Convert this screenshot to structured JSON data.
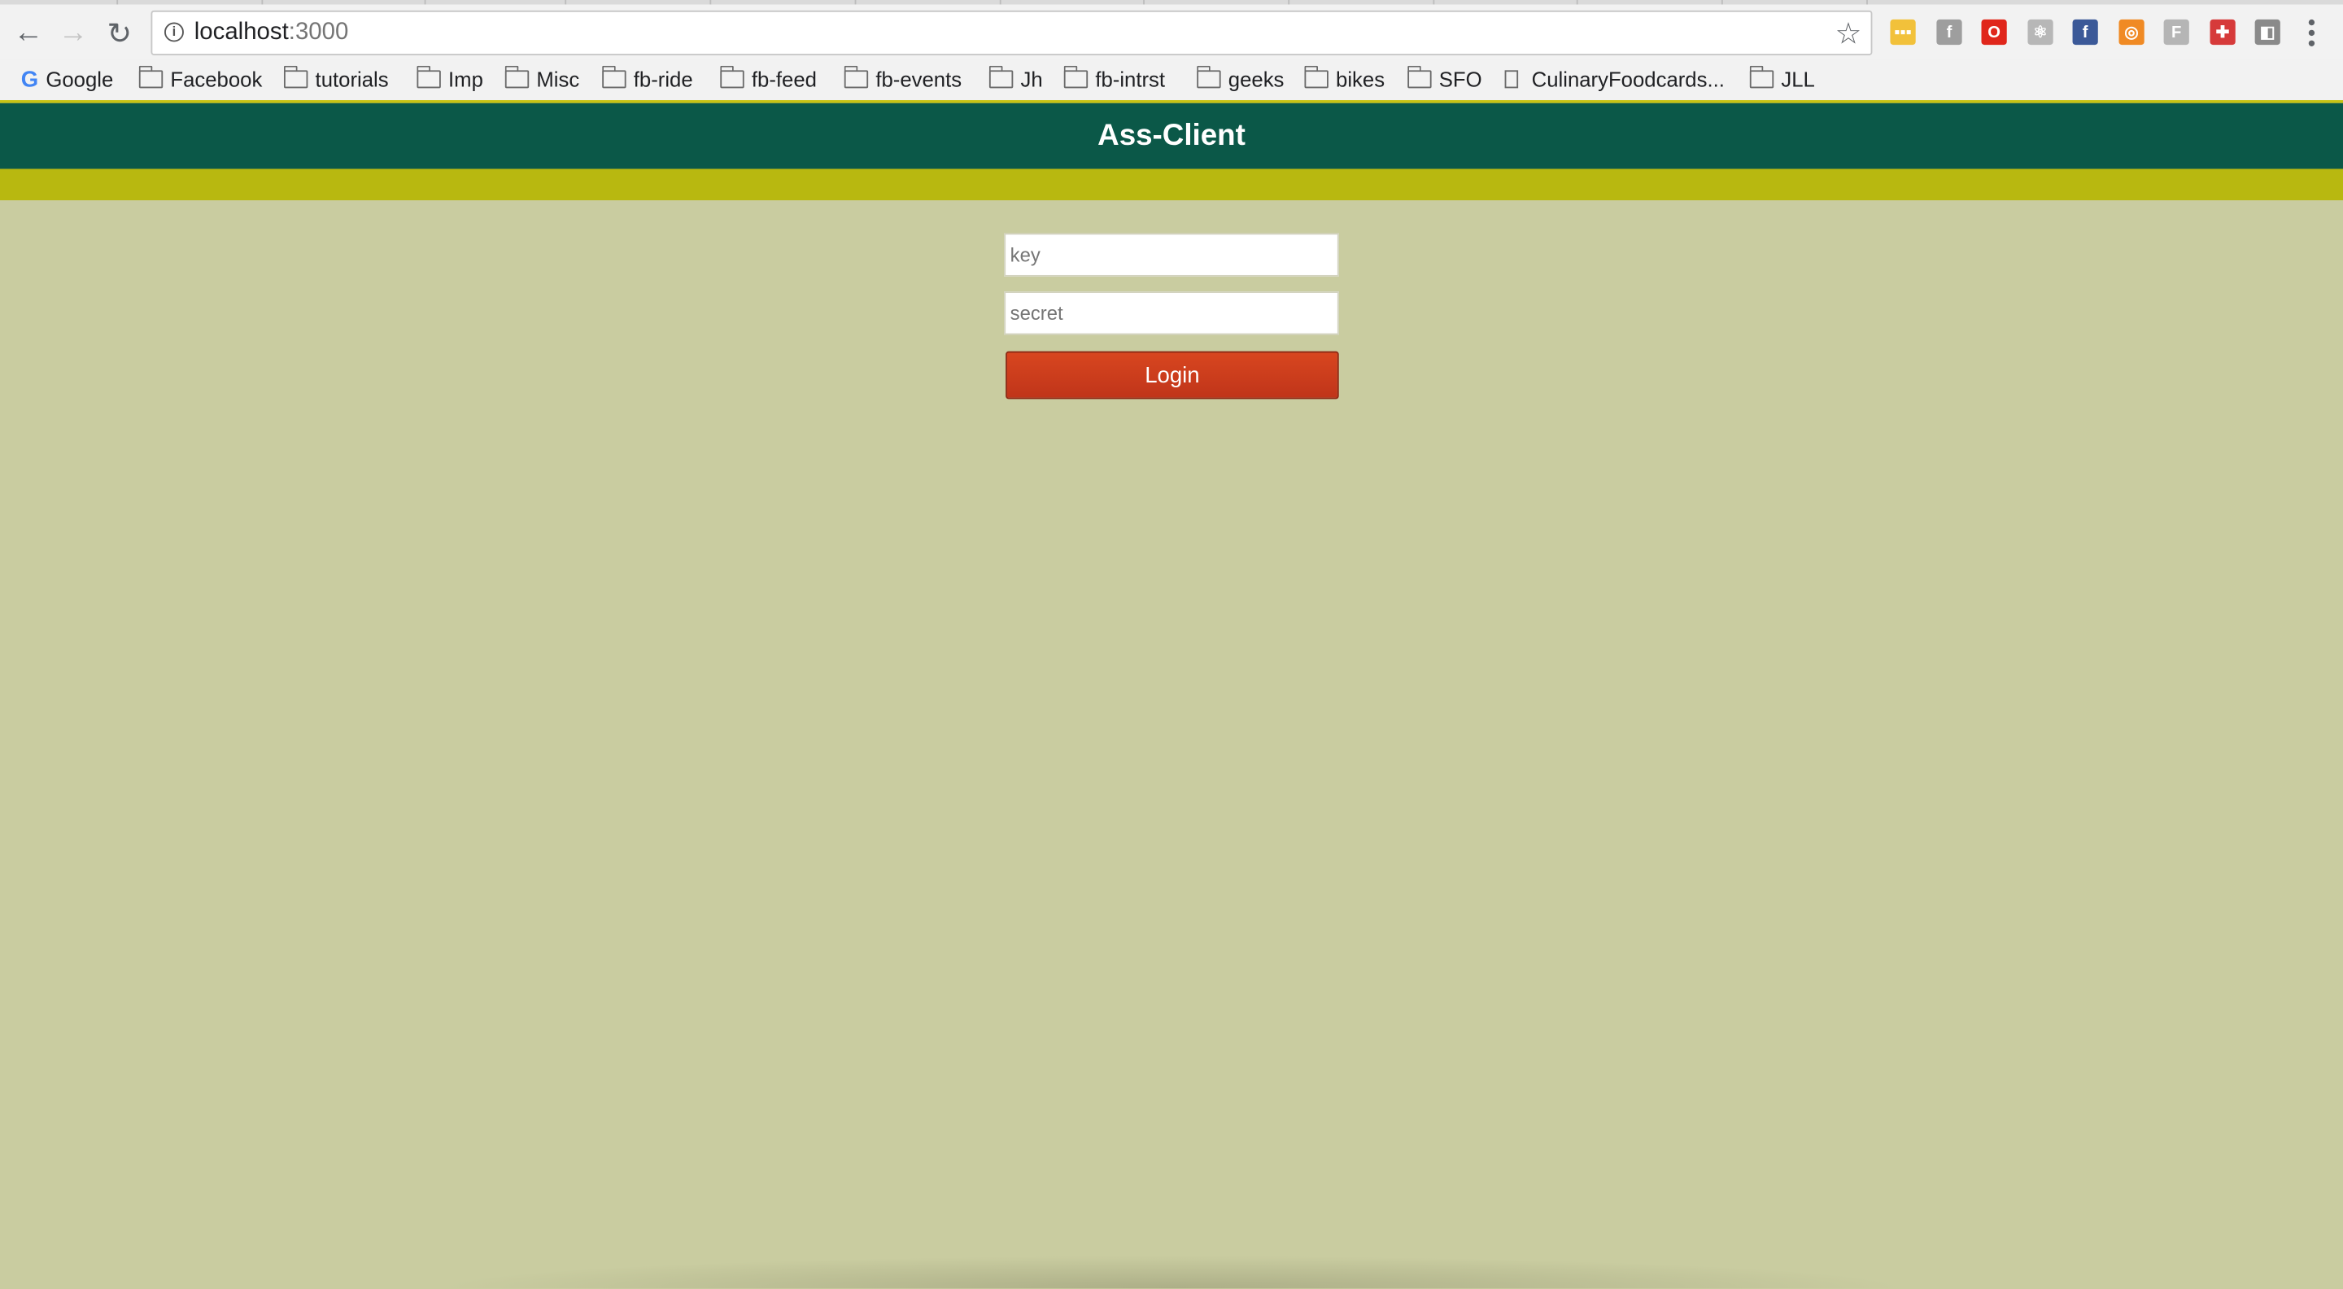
{
  "browser": {
    "url_host": "localhost",
    "url_port": ":3000",
    "bookmarks": [
      {
        "label": "Google",
        "type": "google"
      },
      {
        "label": "Facebook",
        "type": "folder"
      },
      {
        "label": "tutorials",
        "type": "folder"
      },
      {
        "label": "Imp",
        "type": "folder"
      },
      {
        "label": "Misc",
        "type": "folder"
      },
      {
        "label": "fb-ride",
        "type": "folder"
      },
      {
        "label": "fb-feed",
        "type": "folder"
      },
      {
        "label": "fb-events",
        "type": "folder"
      },
      {
        "label": "Jh",
        "type": "folder"
      },
      {
        "label": "fb-intrst",
        "type": "folder"
      },
      {
        "label": "geeks",
        "type": "folder"
      },
      {
        "label": "bikes",
        "type": "folder"
      },
      {
        "label": "SFO",
        "type": "folder"
      },
      {
        "label": "CulinaryFoodcards...",
        "type": "page"
      },
      {
        "label": "JLL",
        "type": "folder"
      }
    ],
    "extensions": [
      {
        "name": "yellow-extension-icon",
        "color": "#f2c13a",
        "glyph": "▪▪▪"
      },
      {
        "name": "facebook-gray-extension-icon",
        "color": "#9e9e9e",
        "glyph": "f"
      },
      {
        "name": "opera-extension-icon",
        "color": "#e0261b",
        "glyph": "O"
      },
      {
        "name": "react-extension-icon",
        "color": "#b7b7b7",
        "glyph": "⚛"
      },
      {
        "name": "facebook-extension-icon",
        "color": "#3b5998",
        "glyph": "f"
      },
      {
        "name": "orange-extension-icon",
        "color": "#f08a24",
        "glyph": "◎"
      },
      {
        "name": "f-gray-extension-icon",
        "color": "#b5b5b5",
        "glyph": "F"
      },
      {
        "name": "red-cross-extension-icon",
        "color": "#d63a3a",
        "glyph": "✚"
      },
      {
        "name": "gray-shield-extension-icon",
        "color": "#8a8a8a",
        "glyph": "◧"
      }
    ]
  },
  "app": {
    "title": "Ass-Client",
    "header_color": "#0b5848",
    "accent_color": "#b8b810",
    "background_color": "#c9cca0"
  },
  "login": {
    "key_placeholder": "key",
    "secret_placeholder": "secret",
    "button_label": "Login",
    "button_color": "#c9391a"
  }
}
